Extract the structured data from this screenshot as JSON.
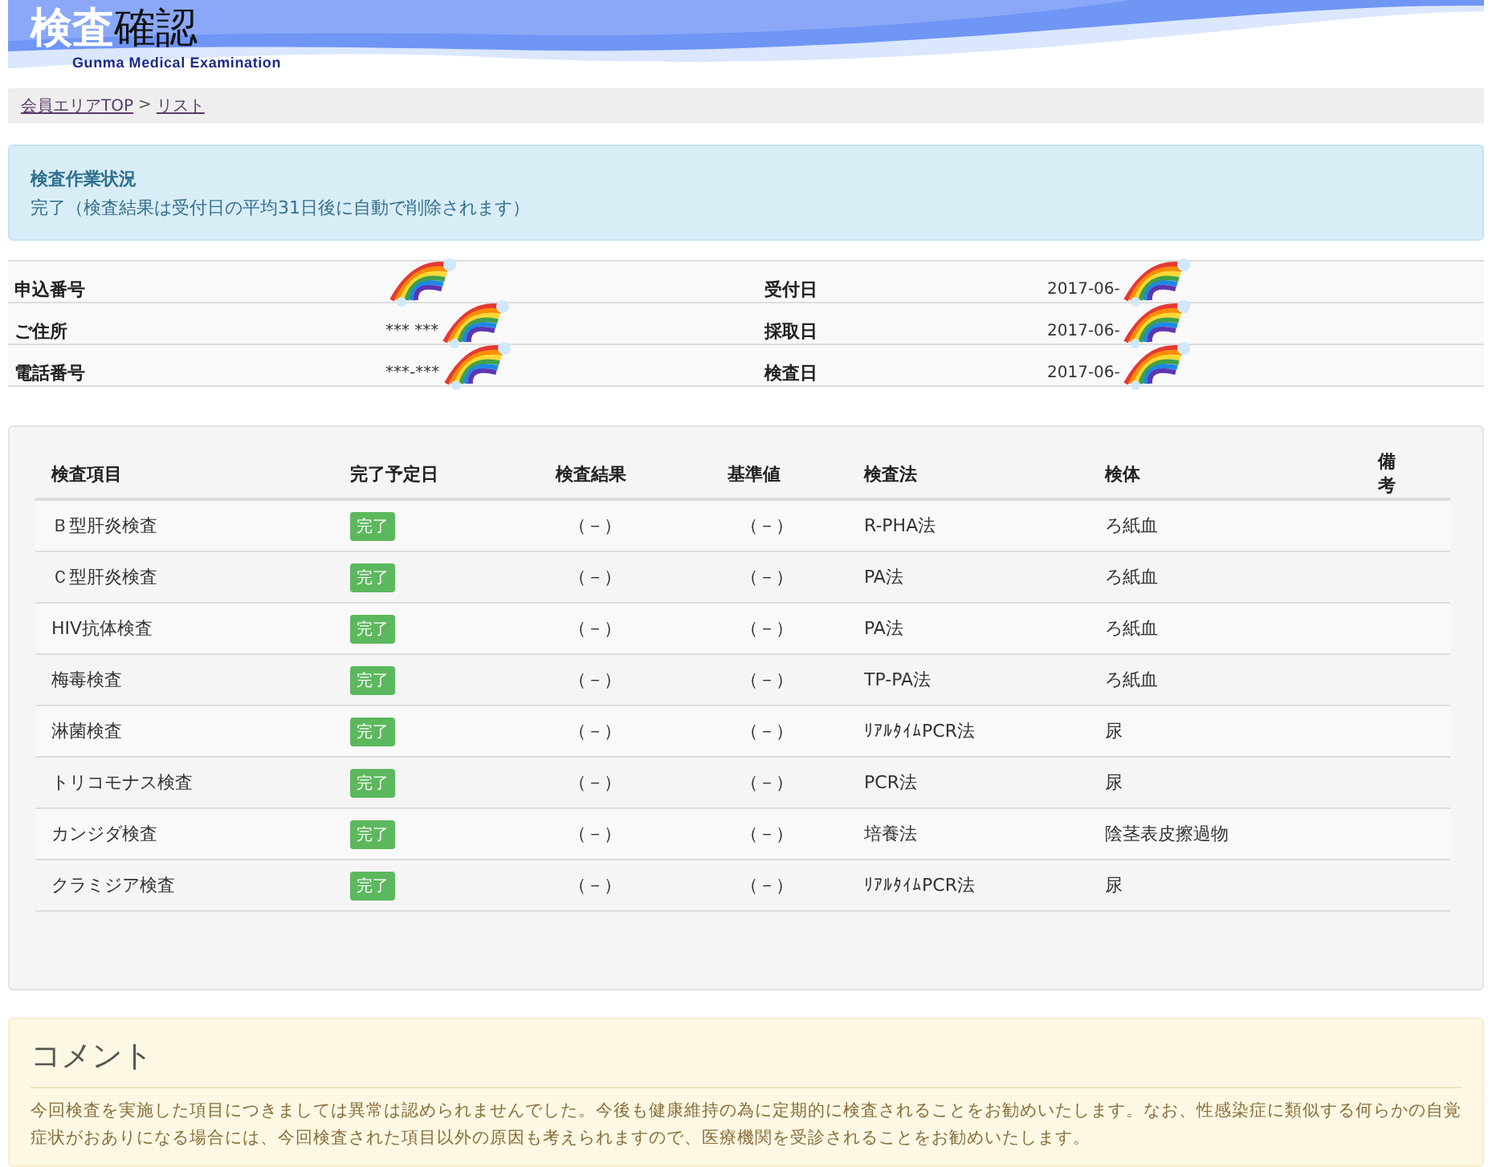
{
  "header": {
    "title_highlight": "検査",
    "title_rest": "確認",
    "subtitle": "Gunma Medical Examination"
  },
  "breadcrumb": [
    {
      "label": "会員エリアTOP"
    },
    {
      "label": "リスト"
    }
  ],
  "breadcrumb_separator": ">",
  "status": {
    "title": "検査作業状況",
    "text": "完了（検査結果は受付日の平均31日後に自動で削除されます）"
  },
  "info_rows": [
    {
      "label": "申込番号",
      "label2": "受付日",
      "value2": "2017-06-"
    },
    {
      "label": "ご住所",
      "value": "*** ***",
      "label2": "採取日",
      "value2": "2017-06-"
    },
    {
      "label": "電話番号",
      "value": "***-***",
      "label2": "検査日",
      "value2": "2017-06-"
    }
  ],
  "results": {
    "columns": [
      "検査項目",
      "完了予定日",
      "検査結果",
      "基準値",
      "検査法",
      "検体",
      "備考"
    ],
    "rows": [
      {
        "item": "Ｂ型肝炎検査",
        "status": "完了",
        "result": "（－）",
        "reference": "（－）",
        "method": "R-PHA法",
        "specimen": "ろ紙血"
      },
      {
        "item": "Ｃ型肝炎検査",
        "status": "完了",
        "result": "（－）",
        "reference": "（－）",
        "method": "PA法",
        "specimen": "ろ紙血"
      },
      {
        "item": "HIV抗体検査",
        "status": "完了",
        "result": "（－）",
        "reference": "（－）",
        "method": "PA法",
        "specimen": "ろ紙血"
      },
      {
        "item": "梅毒検査",
        "status": "完了",
        "result": "（－）",
        "reference": "（－）",
        "method": "TP-PA法",
        "specimen": "ろ紙血"
      },
      {
        "item": "淋菌検査",
        "status": "完了",
        "result": "（－）",
        "reference": "（－）",
        "method": "ﾘｱﾙﾀｲﾑPCR法",
        "specimen": "尿"
      },
      {
        "item": "トリコモナス検査",
        "status": "完了",
        "result": "（－）",
        "reference": "（－）",
        "method": "PCR法",
        "specimen": "尿"
      },
      {
        "item": "カンジダ検査",
        "status": "完了",
        "result": "（－）",
        "reference": "（－）",
        "method": "培養法",
        "specimen": "陰茎表皮擦過物"
      },
      {
        "item": "クラミジア検査",
        "status": "完了",
        "result": "（－）",
        "reference": "（－）",
        "method": "ﾘｱﾙﾀｲﾑPCR法",
        "specimen": "尿"
      }
    ]
  },
  "comment": {
    "title": "コメント",
    "text": "今回検査を実施した項目につきましては異常は認められませんでした。今後も健康維持の為に定期的に検査されることをお勧めいたします。なお、性感染症に類似する何らかの自覚症状がおありになる場合には、今回検査された項目以外の原因も考えられますので、医療機関を受診されることをお勧めいたします。"
  }
}
